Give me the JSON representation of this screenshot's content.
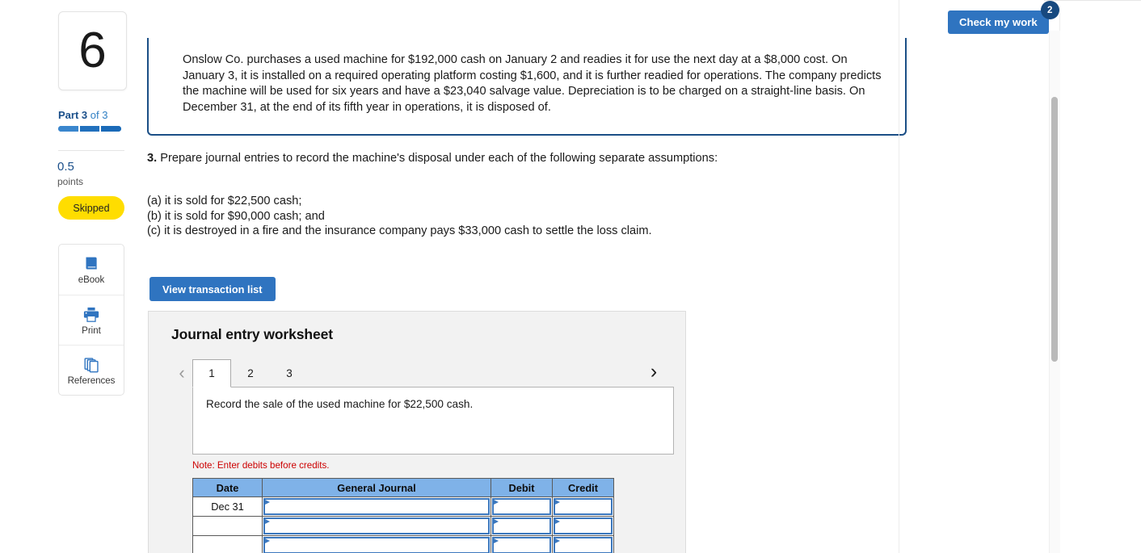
{
  "left_rail": {
    "question_number": "6",
    "part_prefix": "Part 3",
    "part_suffix": "of 3",
    "progress_segments": 3,
    "points_value": "0.5",
    "points_label": "points",
    "status_badge": "Skipped",
    "tools": [
      {
        "label": "eBook",
        "icon": "book-icon"
      },
      {
        "label": "Print",
        "icon": "printer-icon"
      },
      {
        "label": "References",
        "icon": "copy-pages-icon"
      }
    ],
    "accent_blue": "#2f7fc4",
    "badge_yellow": "#ffdd00"
  },
  "header": {
    "check_my_work_label": "Check my work",
    "check_my_work_badge": "2",
    "button_blue": "#2f74c0",
    "badge_navy": "#17497f"
  },
  "problem": {
    "statement": "Onslow Co. purchases a used machine for $192,000 cash on January 2 and readies it for use the next day at a $8,000 cost. On January 3, it is installed on a required operating platform costing $1,600, and it is further readied for operations. The company predicts the machine will be used for six years and have a $23,040 salvage value. Depreciation is to be charged on a straight-line basis. On December 31, at the end of its fifth year in operations, it is disposed of.",
    "border_color": "#1b4f86",
    "question_number": "3.",
    "question_text": "Prepare journal entries to record the machine's disposal under each of the following separate assumptions:",
    "assumptions": [
      "(a) it is sold for $22,500 cash;",
      "(b) it is sold for $90,000 cash; and",
      "(c) it is destroyed in a fire and the insurance company pays $33,000 cash to settle the loss claim."
    ]
  },
  "worksheet": {
    "view_transaction_list_label": "View transaction list",
    "title": "Journal entry worksheet",
    "prev_icon": "chevron-left-icon",
    "next_icon": "chevron-right-icon",
    "tabs": [
      {
        "label": "1",
        "active": true
      },
      {
        "label": "2",
        "active": false
      },
      {
        "label": "3",
        "active": false
      }
    ],
    "panel_text": "Record the sale of the used machine for $22,500 cash.",
    "note": "Note: Enter debits before credits.",
    "table": {
      "columns": [
        "Date",
        "General Journal",
        "Debit",
        "Credit"
      ],
      "header_color": "#7fb2e8",
      "rows": [
        {
          "date": "Dec 31",
          "general_journal": "",
          "debit": "",
          "credit": ""
        },
        {
          "date": "",
          "general_journal": "",
          "debit": "",
          "credit": ""
        },
        {
          "date": "",
          "general_journal": "",
          "debit": "",
          "credit": ""
        }
      ]
    }
  }
}
